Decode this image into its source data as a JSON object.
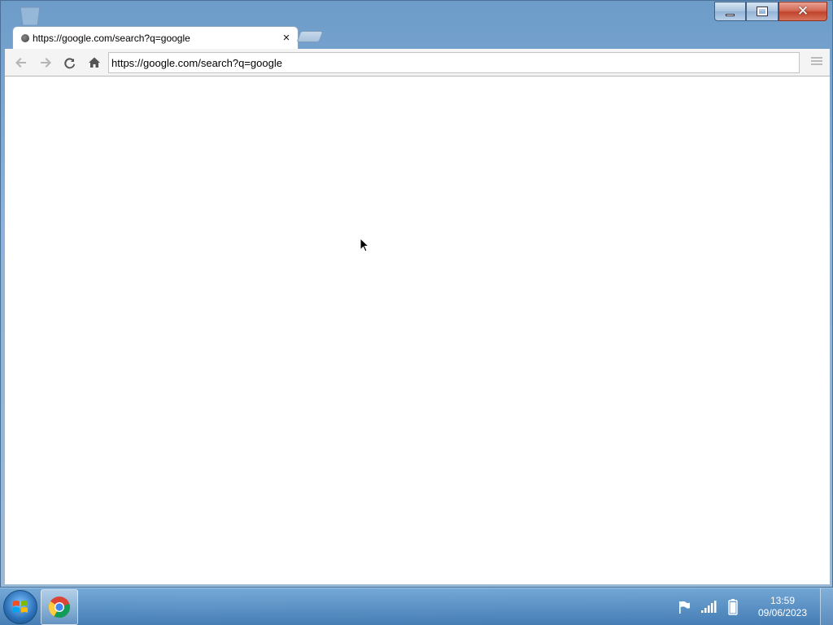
{
  "window": {
    "caption_buttons": [
      "minimize",
      "maximize",
      "close"
    ]
  },
  "tab": {
    "title": "https://google.com/search?q=google",
    "close_glyph": "×"
  },
  "toolbar": {
    "address": "https://google.com/search?q=google",
    "icons": [
      "back-icon",
      "forward-icon",
      "reload-icon",
      "home-icon",
      "menu-icon"
    ]
  },
  "taskbar": {
    "pinned": [
      "chrome-icon"
    ],
    "tray_icons": [
      "flag-icon",
      "network-signal-icon",
      "battery-icon"
    ],
    "time": "13:59",
    "date": "09/06/2023"
  },
  "colors": {
    "frame": "#8db3d8",
    "close_button": "#c0432c",
    "content_bg": "#ffffff"
  }
}
